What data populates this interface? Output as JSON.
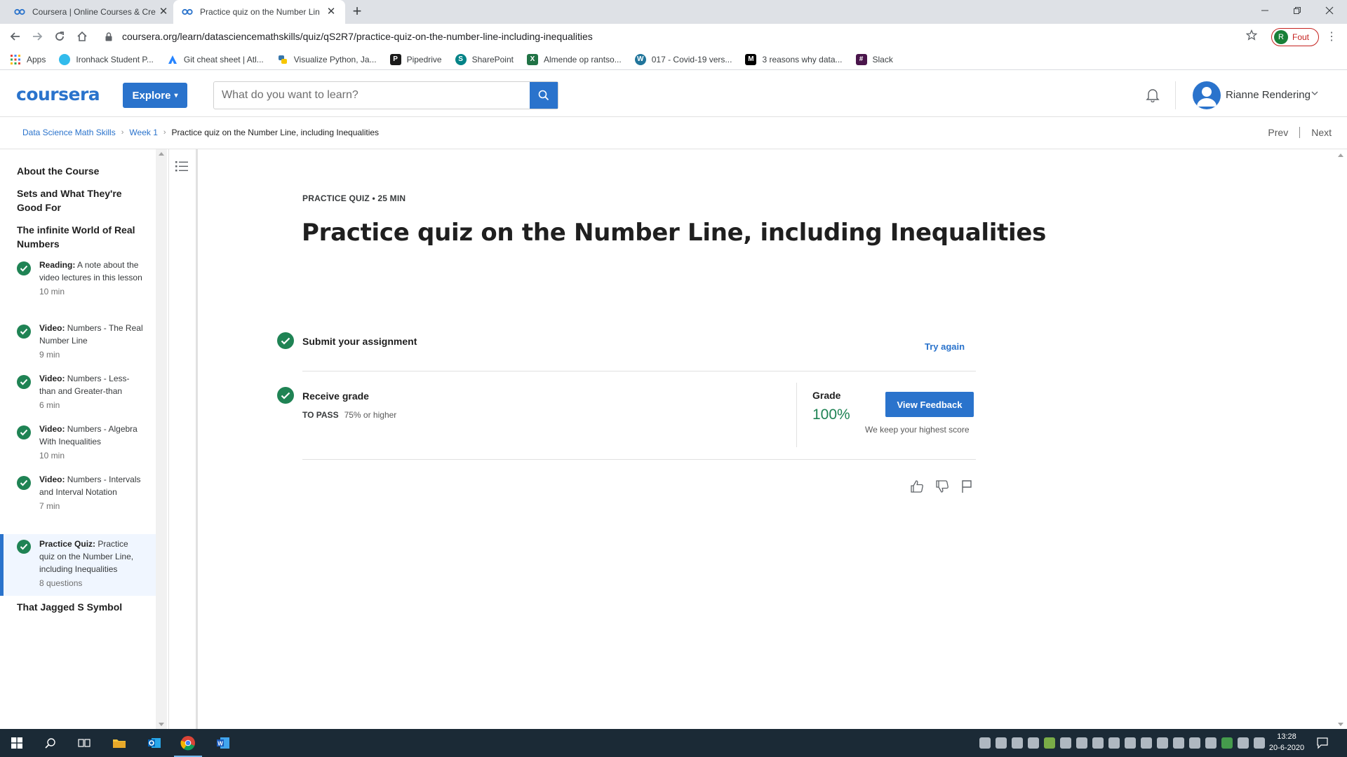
{
  "browser": {
    "tabs": [
      {
        "title": "Coursera | Online Courses & Cre"
      },
      {
        "title": "Practice quiz on the Number Lin"
      }
    ],
    "url": "coursera.org/learn/datasciencemathskills/quiz/qS2R7/practice-quiz-on-the-number-line-including-inequalities",
    "profile_initial": "R",
    "profile_label": "Fout",
    "bookmarks": [
      {
        "label": "Apps",
        "icon": "apps-grid-icon",
        "color": "#ea4335"
      },
      {
        "label": "Ironhack Student P...",
        "icon": "ironhack-icon",
        "color": "#32bbec"
      },
      {
        "label": "Git cheat sheet | Atl...",
        "icon": "atlassian-icon",
        "color": "#2684ff"
      },
      {
        "label": "Visualize Python, Ja...",
        "icon": "python-icon",
        "color": "#f7c600"
      },
      {
        "label": "Pipedrive",
        "icon": "pipedrive-icon",
        "color": "#1a1a1a"
      },
      {
        "label": "SharePoint",
        "icon": "sharepoint-icon",
        "color": "#038387"
      },
      {
        "label": "Almende op rantso...",
        "icon": "excel-icon",
        "color": "#217346"
      },
      {
        "label": "017 - Covid-19 vers...",
        "icon": "wordpress-icon",
        "color": "#21759b"
      },
      {
        "label": "3 reasons why data...",
        "icon": "medium-icon",
        "color": "#000000"
      },
      {
        "label": "Slack",
        "icon": "slack-icon",
        "color": "#4a154b"
      }
    ]
  },
  "header": {
    "logo": "coursera",
    "explore_label": "Explore",
    "search_placeholder": "What do you want to learn?",
    "user_name": "Rianne Rendering"
  },
  "breadcrumb": {
    "items": [
      "Data Science Math Skills",
      "Week 1"
    ],
    "current": "Practice quiz on the Number Line, including Inequalities",
    "prev": "Prev",
    "next": "Next"
  },
  "sidebar": {
    "sections": [
      {
        "title": "About the Course"
      },
      {
        "title": "Sets and What They're Good For"
      },
      {
        "title": "The infinite World of Real Numbers"
      },
      {
        "title": "That Jagged S Symbol"
      }
    ],
    "items": [
      {
        "type": "Reading:",
        "title": "A note about the video lectures in this lesson",
        "meta": "10 min"
      },
      {
        "type": "Video:",
        "title": "Numbers - The Real Number Line",
        "meta": "9 min"
      },
      {
        "type": "Video:",
        "title": "Numbers - Less-than and Greater-than",
        "meta": "6 min"
      },
      {
        "type": "Video:",
        "title": "Numbers - Algebra With Inequalities",
        "meta": "10 min"
      },
      {
        "type": "Video:",
        "title": "Numbers - Intervals and Interval Notation",
        "meta": "7 min"
      },
      {
        "type": "Practice Quiz:",
        "title": "Practice quiz on the Number Line, including Inequalities",
        "meta": "8 questions",
        "selected": true
      }
    ]
  },
  "main": {
    "kicker": "PRACTICE QUIZ • 25 MIN",
    "title": "Practice quiz on the Number Line, including Inequalities",
    "submit_label": "Submit your assignment",
    "try_again": "Try again",
    "receive_label": "Receive grade",
    "to_pass_label": "TO PASS",
    "to_pass_value": "75% or higher",
    "grade_label": "Grade",
    "grade_value": "100%",
    "view_feedback": "View Feedback",
    "keep_note": "We keep your highest score"
  },
  "taskbar": {
    "time": "13:28",
    "date": "20-6-2020"
  },
  "colors": {
    "brand": "#2a73cc",
    "success": "#1f8354"
  }
}
